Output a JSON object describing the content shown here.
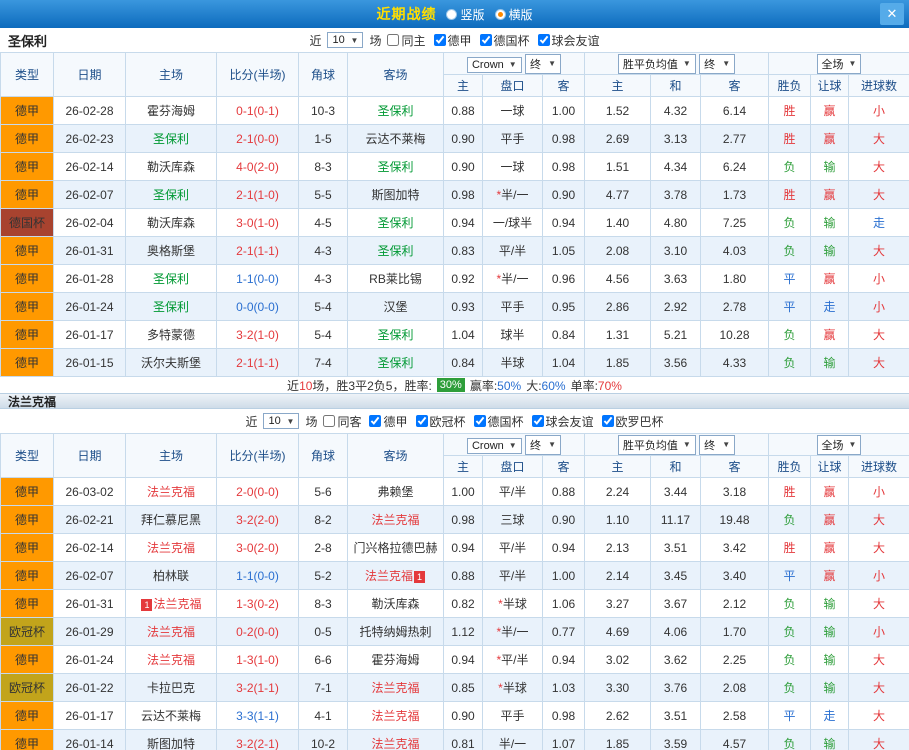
{
  "topbar": {
    "title": "近期战绩",
    "vertical_label": "竖版",
    "horizontal_label": "横版",
    "selected_layout": "横版",
    "close": "✕"
  },
  "dropdowns": {
    "near": "近",
    "count": "10",
    "matches": "场",
    "crow": "Crown",
    "final": "终",
    "avg": "胜平负均值",
    "full": "全场"
  },
  "header_labels": {
    "type": "类型",
    "date": "日期",
    "home": "主场",
    "score": "比分(半场)",
    "corners": "角球",
    "away": "客场",
    "odds_home": "主",
    "odds_handicap": "盘口",
    "odds_away": "客",
    "avg_home": "主",
    "avg_draw": "和",
    "avg_away": "客",
    "result": "胜负",
    "handicap_result": "让球",
    "goals": "进球数"
  },
  "colors": {
    "league": {
      "德甲": "#ff9900",
      "德国杯": "#a8432f",
      "欧冠杯": "#c2a41b"
    },
    "result": {
      "胜": "#e4393c",
      "负": "#2e9e3a",
      "平": "#2a6fd0",
      "赢": "#e4393c",
      "输": "#2e9e3a",
      "走": "#2a6fd0",
      "大": "#e4393c",
      "小": "#e4393c"
    },
    "score_win": "#e4393c",
    "score_draw": "#2a6fd0",
    "accent_title": "#ffde00"
  },
  "sections": [
    {
      "team": "圣保利",
      "team_color": "#009933",
      "filters": {
        "checkboxes": [
          {
            "label": "同主",
            "checked": false
          },
          {
            "label": "德甲",
            "checked": true
          },
          {
            "label": "德国杯",
            "checked": true
          },
          {
            "label": "球会友谊",
            "checked": true
          }
        ]
      },
      "rows": [
        {
          "league": "德甲",
          "date": "26-02-28",
          "home": "霍芬海姆",
          "score": "0-1(0-1)",
          "corners": "10-3",
          "away": "圣保利",
          "crow_home": "0.88",
          "handicap": "一球",
          "crow_away": "1.00",
          "avg_home": "1.52",
          "avg_draw": "4.32",
          "avg_away": "6.14",
          "result": "胜",
          "handicap_result": "赢",
          "goals_result": "小"
        },
        {
          "league": "德甲",
          "date": "26-02-23",
          "home": "圣保利",
          "score": "2-1(0-0)",
          "corners": "1-5",
          "away": "云达不莱梅",
          "crow_home": "0.90",
          "handicap": "平手",
          "crow_away": "0.98",
          "avg_home": "2.69",
          "avg_draw": "3.13",
          "avg_away": "2.77",
          "result": "胜",
          "handicap_result": "赢",
          "goals_result": "大"
        },
        {
          "league": "德甲",
          "date": "26-02-14",
          "home": "勒沃库森",
          "score": "4-0(2-0)",
          "corners": "8-3",
          "away": "圣保利",
          "crow_home": "0.90",
          "handicap": "一球",
          "crow_away": "0.98",
          "avg_home": "1.51",
          "avg_draw": "4.34",
          "avg_away": "6.24",
          "result": "负",
          "handicap_result": "输",
          "goals_result": "大"
        },
        {
          "league": "德甲",
          "date": "26-02-07",
          "home": "圣保利",
          "score": "2-1(1-0)",
          "corners": "5-5",
          "away": "斯图加特",
          "crow_home": "0.98",
          "handicap": "*半/一",
          "crow_away": "0.90",
          "avg_home": "4.77",
          "avg_draw": "3.78",
          "avg_away": "1.73",
          "result": "胜",
          "handicap_result": "赢",
          "goals_result": "大"
        },
        {
          "league": "德国杯",
          "date": "26-02-04",
          "home": "勒沃库森",
          "score": "3-0(1-0)",
          "corners": "4-5",
          "away": "圣保利",
          "crow_home": "0.94",
          "handicap": "一/球半",
          "crow_away": "0.94",
          "avg_home": "1.40",
          "avg_draw": "4.80",
          "avg_away": "7.25",
          "result": "负",
          "handicap_result": "输",
          "goals_result": "走"
        },
        {
          "league": "德甲",
          "date": "26-01-31",
          "home": "奥格斯堡",
          "score": "2-1(1-1)",
          "corners": "4-3",
          "away": "圣保利",
          "crow_home": "0.83",
          "handicap": "平/半",
          "crow_away": "1.05",
          "avg_home": "2.08",
          "avg_draw": "3.10",
          "avg_away": "4.03",
          "result": "负",
          "handicap_result": "输",
          "goals_result": "大"
        },
        {
          "league": "德甲",
          "date": "26-01-28",
          "home": "圣保利",
          "score": "1-1(0-0)",
          "corners": "4-3",
          "away": "RB莱比锡",
          "crow_home": "0.92",
          "handicap": "*半/一",
          "crow_away": "0.96",
          "avg_home": "4.56",
          "avg_draw": "3.63",
          "avg_away": "1.80",
          "result": "平",
          "handicap_result": "赢",
          "goals_result": "小"
        },
        {
          "league": "德甲",
          "date": "26-01-24",
          "home": "圣保利",
          "score": "0-0(0-0)",
          "corners": "5-4",
          "away": "汉堡",
          "crow_home": "0.93",
          "handicap": "平手",
          "crow_away": "0.95",
          "avg_home": "2.86",
          "avg_draw": "2.92",
          "avg_away": "2.78",
          "result": "平",
          "handicap_result": "走",
          "goals_result": "小"
        },
        {
          "league": "德甲",
          "date": "26-01-17",
          "home": "多特蒙德",
          "score": "3-2(1-0)",
          "corners": "5-4",
          "away": "圣保利",
          "crow_home": "1.04",
          "handicap": "球半",
          "crow_away": "0.84",
          "avg_home": "1.31",
          "avg_draw": "5.21",
          "avg_away": "10.28",
          "result": "负",
          "handicap_result": "赢",
          "goals_result": "大"
        },
        {
          "league": "德甲",
          "date": "26-01-15",
          "home": "沃尔夫斯堡",
          "score": "2-1(1-1)",
          "corners": "7-4",
          "away": "圣保利",
          "crow_home": "0.84",
          "handicap": "半球",
          "crow_away": "1.04",
          "avg_home": "1.85",
          "avg_draw": "3.56",
          "avg_away": "4.33",
          "result": "负",
          "handicap_result": "输",
          "goals_result": "大"
        }
      ],
      "summary": {
        "t1": "近",
        "count": "10",
        "t2": "场，胜3平2负5，胜率:",
        "win_rate": "30%",
        "l1": "赢率:",
        "v1": "50%",
        "l2": "大:",
        "v2": "60%",
        "l3": "单率:",
        "v3": "70%"
      }
    },
    {
      "team": "法兰克福",
      "team_color": "#e4393c",
      "filters": {
        "checkboxes": [
          {
            "label": "同客",
            "checked": false
          },
          {
            "label": "德甲",
            "checked": true
          },
          {
            "label": "欧冠杯",
            "checked": true
          },
          {
            "label": "德国杯",
            "checked": true
          },
          {
            "label": "球会友谊",
            "checked": true
          },
          {
            "label": "欧罗巴杯",
            "checked": true
          }
        ]
      },
      "rows": [
        {
          "league": "德甲",
          "date": "26-03-02",
          "home": "法兰克福",
          "score": "2-0(0-0)",
          "corners": "5-6",
          "away": "弗赖堡",
          "crow_home": "1.00",
          "handicap": "平/半",
          "crow_away": "0.88",
          "avg_home": "2.24",
          "avg_draw": "3.44",
          "avg_away": "3.18",
          "result": "胜",
          "handicap_result": "赢",
          "goals_result": "小"
        },
        {
          "league": "德甲",
          "date": "26-02-21",
          "home": "拜仁慕尼黑",
          "score": "3-2(2-0)",
          "corners": "8-2",
          "away": "法兰克福",
          "crow_home": "0.98",
          "handicap": "三球",
          "crow_away": "0.90",
          "avg_home": "1.10",
          "avg_draw": "11.17",
          "avg_away": "19.48",
          "result": "负",
          "handicap_result": "赢",
          "goals_result": "大"
        },
        {
          "league": "德甲",
          "date": "26-02-14",
          "home": "法兰克福",
          "score": "3-0(2-0)",
          "corners": "2-8",
          "away": "门兴格拉德巴赫",
          "crow_home": "0.94",
          "handicap": "平/半",
          "crow_away": "0.94",
          "avg_home": "2.13",
          "avg_draw": "3.51",
          "avg_away": "3.42",
          "result": "胜",
          "handicap_result": "赢",
          "goals_result": "大"
        },
        {
          "league": "德甲",
          "date": "26-02-07",
          "home": "柏林联",
          "score": "1-1(0-0)",
          "corners": "5-2",
          "away": "法兰克福",
          "away_card": "1",
          "crow_home": "0.88",
          "handicap": "平/半",
          "crow_away": "1.00",
          "avg_home": "2.14",
          "avg_draw": "3.45",
          "avg_away": "3.40",
          "result": "平",
          "handicap_result": "赢",
          "goals_result": "小"
        },
        {
          "league": "德甲",
          "date": "26-01-31",
          "home": "法兰克福",
          "home_card": "1",
          "score": "1-3(0-2)",
          "corners": "8-3",
          "away": "勒沃库森",
          "crow_home": "0.82",
          "handicap": "*半球",
          "crow_away": "1.06",
          "avg_home": "3.27",
          "avg_draw": "3.67",
          "avg_away": "2.12",
          "result": "负",
          "handicap_result": "输",
          "goals_result": "大"
        },
        {
          "league": "欧冠杯",
          "date": "26-01-29",
          "home": "法兰克福",
          "score": "0-2(0-0)",
          "corners": "0-5",
          "away": "托特纳姆热刺",
          "crow_home": "1.12",
          "handicap": "*半/一",
          "crow_away": "0.77",
          "avg_home": "4.69",
          "avg_draw": "4.06",
          "avg_away": "1.70",
          "result": "负",
          "handicap_result": "输",
          "goals_result": "小"
        },
        {
          "league": "德甲",
          "date": "26-01-24",
          "home": "法兰克福",
          "score": "1-3(1-0)",
          "corners": "6-6",
          "away": "霍芬海姆",
          "crow_home": "0.94",
          "handicap": "*平/半",
          "crow_away": "0.94",
          "avg_home": "3.02",
          "avg_draw": "3.62",
          "avg_away": "2.25",
          "result": "负",
          "handicap_result": "输",
          "goals_result": "大"
        },
        {
          "league": "欧冠杯",
          "date": "26-01-22",
          "home": "卡拉巴克",
          "score": "3-2(1-1)",
          "corners": "7-1",
          "away": "法兰克福",
          "crow_home": "0.85",
          "handicap": "*半球",
          "crow_away": "1.03",
          "avg_home": "3.30",
          "avg_draw": "3.76",
          "avg_away": "2.08",
          "result": "负",
          "handicap_result": "输",
          "goals_result": "大"
        },
        {
          "league": "德甲",
          "date": "26-01-17",
          "home": "云达不莱梅",
          "score": "3-3(1-1)",
          "corners": "4-1",
          "away": "法兰克福",
          "crow_home": "0.90",
          "handicap": "平手",
          "crow_away": "0.98",
          "avg_home": "2.62",
          "avg_draw": "3.51",
          "avg_away": "2.58",
          "result": "平",
          "handicap_result": "走",
          "goals_result": "大"
        },
        {
          "league": "德甲",
          "date": "26-01-14",
          "home": "斯图加特",
          "score": "3-2(2-1)",
          "corners": "10-2",
          "away": "法兰克福",
          "crow_home": "0.81",
          "handicap": "半/一",
          "crow_away": "1.07",
          "avg_home": "1.85",
          "avg_draw": "3.59",
          "avg_away": "4.57",
          "result": "负",
          "handicap_result": "输",
          "goals_result": "大"
        }
      ]
    }
  ]
}
